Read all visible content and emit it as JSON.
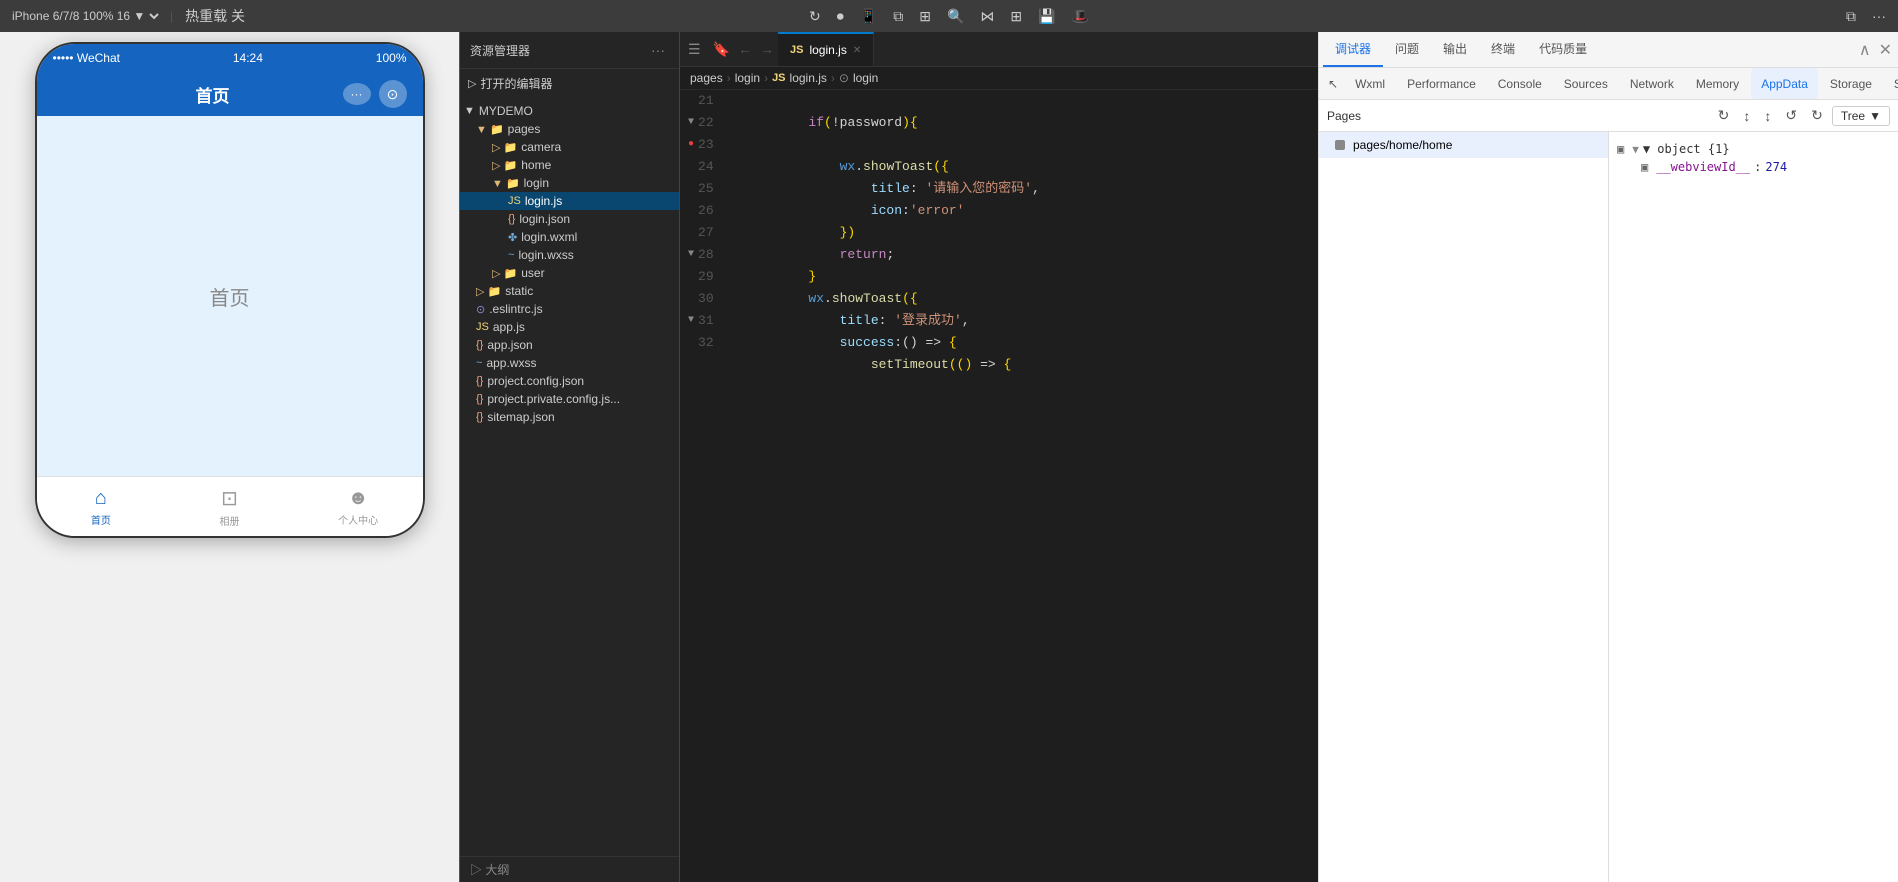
{
  "topToolbar": {
    "deviceLabel": "iPhone 6/7/8",
    "zoomLabel": "100%",
    "zoomArrow": "▼",
    "hotReloadLabel": "热重载 关",
    "hotReloadArrow": "▼"
  },
  "phoneSimulator": {
    "statusTime": "14:24",
    "statusSignal": "••••• WeChat",
    "statusBattery": "100%",
    "navTitle": "首页",
    "contentText": "首页",
    "bottomNav": [
      {
        "label": "首页",
        "icon": "⌂",
        "active": true
      },
      {
        "label": "相册",
        "icon": "⊡",
        "active": false
      },
      {
        "label": "个人中心",
        "icon": "☻",
        "active": false
      }
    ]
  },
  "fileExplorer": {
    "title": "资源管理器",
    "moreIcon": "···",
    "sections": [
      {
        "label": "打开的编辑器",
        "expanded": false
      },
      {
        "label": "MYDEMO",
        "expanded": true,
        "children": [
          {
            "label": "pages",
            "type": "folder",
            "expanded": true,
            "children": [
              {
                "label": "camera",
                "type": "folder",
                "expanded": false
              },
              {
                "label": "home",
                "type": "folder",
                "expanded": false
              },
              {
                "label": "login",
                "type": "folder",
                "expanded": true,
                "children": [
                  {
                    "label": "login.js",
                    "type": "js",
                    "active": true
                  },
                  {
                    "label": "login.json",
                    "type": "json"
                  },
                  {
                    "label": "login.wxml",
                    "type": "wxml"
                  },
                  {
                    "label": "login.wxss",
                    "type": "wxss"
                  }
                ]
              },
              {
                "label": "user",
                "type": "folder",
                "expanded": false
              }
            ]
          },
          {
            "label": "static",
            "type": "folder",
            "expanded": false
          },
          {
            "label": ".eslintrc.js",
            "type": "eslint"
          },
          {
            "label": "app.js",
            "type": "js"
          },
          {
            "label": "app.json",
            "type": "json"
          },
          {
            "label": "app.wxss",
            "type": "wxss"
          },
          {
            "label": "project.config.json",
            "type": "json"
          },
          {
            "label": "project.private.config.js...",
            "type": "json"
          },
          {
            "label": "sitemap.json",
            "type": "json"
          }
        ]
      }
    ],
    "bottomLabel": "▷ 大纲"
  },
  "editor": {
    "tab": {
      "icon": "JS",
      "label": "login.js",
      "isActive": true
    },
    "breadcrumb": {
      "items": [
        "pages",
        "login",
        "login.js",
        "login"
      ]
    },
    "lines": [
      {
        "num": 21,
        "foldable": false,
        "content": "if(!password){",
        "highlight": []
      },
      {
        "num": 22,
        "foldable": true,
        "content": "",
        "highlight": []
      },
      {
        "num": 23,
        "foldable": false,
        "hasError": true,
        "content": "wx.showToast({",
        "highlight": []
      },
      {
        "num": 24,
        "foldable": false,
        "content": "  title: '请输入您的密码',",
        "highlight": []
      },
      {
        "num": 25,
        "foldable": false,
        "content": "  icon:'error'",
        "highlight": []
      },
      {
        "num": 26,
        "foldable": false,
        "content": "})",
        "highlight": []
      },
      {
        "num": 27,
        "foldable": false,
        "content": "return;",
        "highlight": []
      },
      {
        "num": 28,
        "foldable": true,
        "content": "}",
        "highlight": []
      },
      {
        "num": 29,
        "foldable": false,
        "content": "wx.showToast({",
        "highlight": []
      },
      {
        "num": 30,
        "foldable": false,
        "content": "  title: '登录成功',",
        "highlight": []
      },
      {
        "num": 31,
        "foldable": true,
        "content": "  success:() => {",
        "highlight": []
      },
      {
        "num": 32,
        "foldable": false,
        "content": "    setTimeout(() => {",
        "highlight": []
      }
    ]
  },
  "devtools": {
    "tabs": [
      {
        "label": "调试器",
        "active": true
      },
      {
        "label": "问题",
        "active": false
      },
      {
        "label": "输出",
        "active": false
      },
      {
        "label": "终端",
        "active": false
      },
      {
        "label": "代码质量",
        "active": false
      }
    ],
    "subtabs": [
      {
        "label": "Wxml",
        "active": false
      },
      {
        "label": "Performance",
        "active": false
      },
      {
        "label": "Console",
        "active": false
      },
      {
        "label": "Sources",
        "active": false
      },
      {
        "label": "Network",
        "active": false
      },
      {
        "label": "Memory",
        "active": false
      },
      {
        "label": "AppData",
        "active": true
      },
      {
        "label": "Storage",
        "active": false
      },
      {
        "label": "Security",
        "active": false
      }
    ],
    "moreBtn": "»",
    "pagesLabel": "Pages",
    "treeLabel": "Tree",
    "treeArrow": "▼",
    "pages": [
      {
        "path": "pages/home/home",
        "selected": true
      }
    ],
    "dataTree": {
      "objectLabel": "▼ object {1}",
      "property": "__webviewId__",
      "value": "274"
    }
  }
}
